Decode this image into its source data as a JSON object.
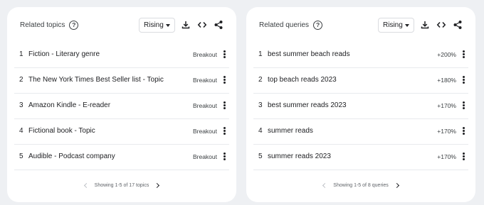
{
  "panels": [
    {
      "title": "Related topics",
      "dropdown": "Rising",
      "rows": [
        {
          "rank": "1",
          "label": "Fiction - Literary genre",
          "value": "Breakout"
        },
        {
          "rank": "2",
          "label": "The New York Times Best Seller list - Topic",
          "value": "Breakout"
        },
        {
          "rank": "3",
          "label": "Amazon Kindle - E-reader",
          "value": "Breakout"
        },
        {
          "rank": "4",
          "label": "Fictional book - Topic",
          "value": "Breakout"
        },
        {
          "rank": "5",
          "label": "Audible - Podcast company",
          "value": "Breakout"
        }
      ],
      "pager": "Showing 1-5 of 17 topics"
    },
    {
      "title": "Related queries",
      "dropdown": "Rising",
      "rows": [
        {
          "rank": "1",
          "label": "best summer beach reads",
          "value": "+200%"
        },
        {
          "rank": "2",
          "label": "top beach reads 2023",
          "value": "+180%"
        },
        {
          "rank": "3",
          "label": "best summer reads 2023",
          "value": "+170%"
        },
        {
          "rank": "4",
          "label": "summer reads",
          "value": "+170%"
        },
        {
          "rank": "5",
          "label": "summer reads 2023",
          "value": "+170%"
        }
      ],
      "pager": "Showing 1-5 of 8 queries"
    }
  ],
  "icons": {
    "help": "help-circle-icon",
    "download": "download-icon",
    "embed": "embed-code-icon",
    "share": "share-icon",
    "more": "more-vert-icon",
    "prev": "chevron-left-icon",
    "next": "chevron-right-icon"
  },
  "colors": {
    "background": "#eef0f3",
    "card": "#ffffff",
    "text": "#202124",
    "divider": "#e8eaed"
  }
}
